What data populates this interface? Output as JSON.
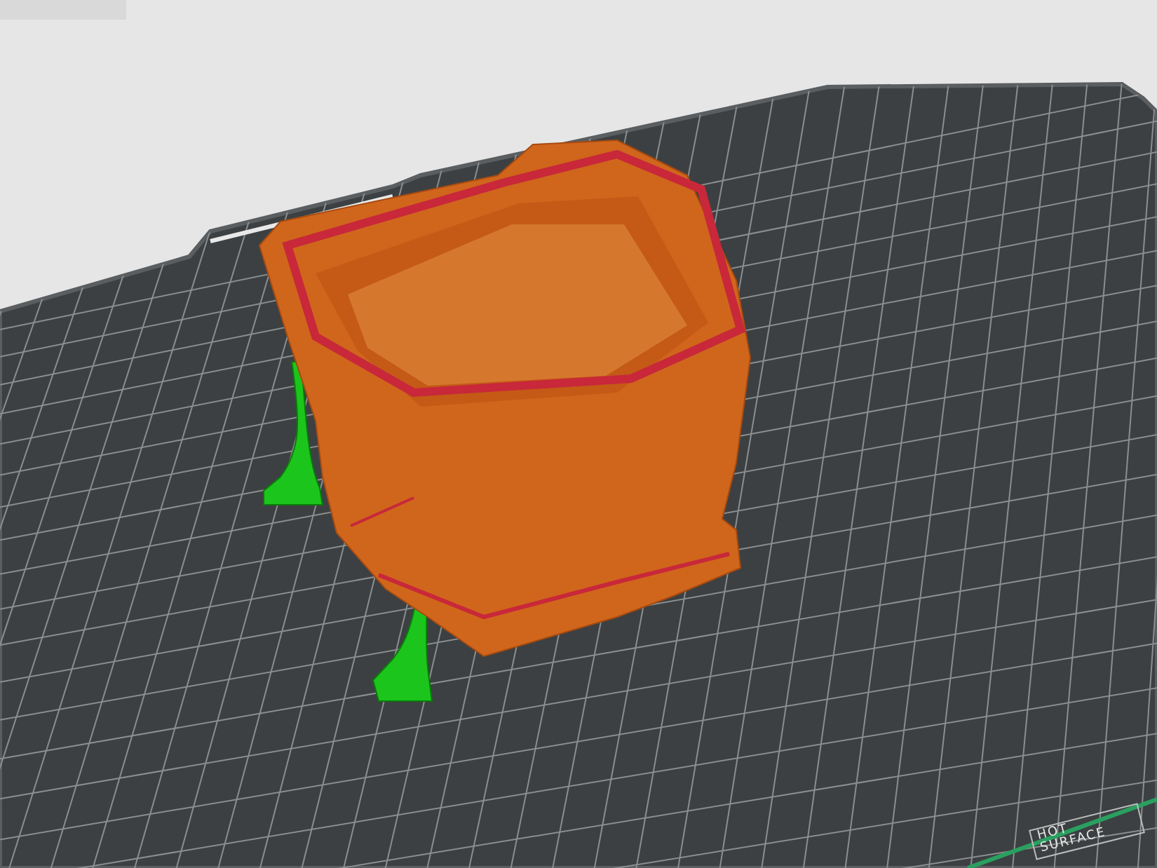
{
  "viewport": {
    "bed_label": "HOT SURFACE"
  }
}
